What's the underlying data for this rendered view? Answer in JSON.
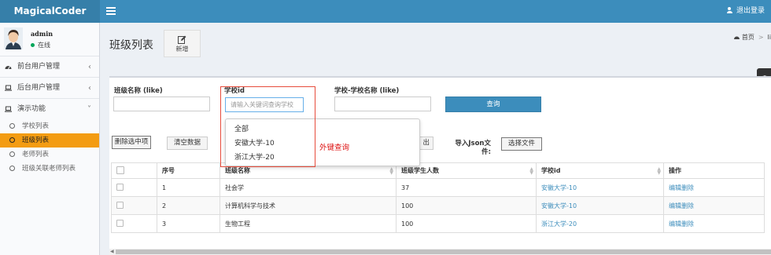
{
  "app": {
    "logo": "MagicalCoder",
    "logout": "退出登录"
  },
  "user": {
    "name": "admin",
    "status": "在线"
  },
  "sidebar": {
    "items": [
      {
        "label": "前台用户管理",
        "caret": "‹"
      },
      {
        "label": "后台用户管理",
        "caret": "‹"
      },
      {
        "label": "演示功能",
        "caret": "˅"
      }
    ],
    "subitems": [
      {
        "label": "学校列表"
      },
      {
        "label": "班级列表",
        "active": true
      },
      {
        "label": "老师列表"
      },
      {
        "label": "班级关联老师列表"
      }
    ]
  },
  "header": {
    "title": "班级列表",
    "add_label": "新增",
    "breadcrumb": [
      "首页",
      "li"
    ]
  },
  "filters": {
    "class_name_label": "班级名称 (like)",
    "school_id_label": "学校id",
    "school_id_placeholder": "请输入关键词查询学校",
    "school_name_label": "学校-学校名称 (like)",
    "query_label": "查询",
    "fk_label": "外键查询",
    "dropdown_options": [
      "全部",
      "安徽大学-10",
      "浙江大学-20"
    ]
  },
  "actions": {
    "delete_selected": "删除选中项",
    "clear_data": "清空数据",
    "export_partial": "出",
    "import_label": "导入Json文件:",
    "choose_file": "选择文件"
  },
  "table": {
    "columns": [
      "序号",
      "班级名称",
      "班级学生人数",
      "学校id",
      "操作"
    ],
    "rows": [
      {
        "index": "1",
        "name": "社会学",
        "count": "37",
        "school": "安徽大学-10",
        "ops": "编辑删除"
      },
      {
        "index": "2",
        "name": "计算机科学与技术",
        "count": "100",
        "school": "安徽大学-10",
        "ops": "编辑删除"
      },
      {
        "index": "3",
        "name": "生物工程",
        "count": "100",
        "school": "浙江大学-20",
        "ops": "编辑删除"
      }
    ]
  },
  "colors": {
    "header": "#3c8dbc",
    "logo_bg": "#367fa9",
    "active": "#f39c12",
    "accent_red": "#e74c3c",
    "link": "#3c8dbc"
  }
}
